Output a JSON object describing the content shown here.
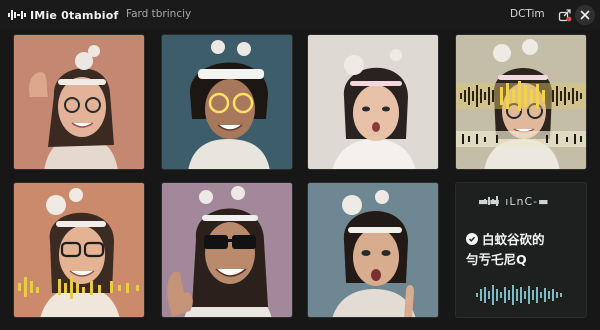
{
  "app": {
    "title": "IMie 0tambiof",
    "subtitle": "Fard tbrinciy",
    "status": "DCTim",
    "icons": {
      "logo": "waveform-logo-icon",
      "share": "share-icon",
      "close": "close-icon"
    }
  },
  "grid": {
    "tiles": [
      {
        "id": "tile-1",
        "subject": "participant-smiling-glasses",
        "bg": "#c98f79"
      },
      {
        "id": "tile-2",
        "subject": "participant-glowing-glasses",
        "bg": "#3e5d6b"
      },
      {
        "id": "tile-3",
        "subject": "participant-surprised",
        "bg": "#dedad3"
      },
      {
        "id": "tile-4",
        "subject": "participant-with-waveform",
        "bg": "#c4bea8",
        "accent": "#d6b84a"
      },
      {
        "id": "tile-5",
        "subject": "participant-glasses-waveform",
        "bg": "#cc8a6d",
        "accent": "#d8c24c"
      },
      {
        "id": "tile-6",
        "subject": "participant-sunglasses",
        "bg": "#a3879b"
      },
      {
        "id": "tile-7",
        "subject": "participant-pointing",
        "bg": "#6f8793"
      }
    ],
    "panel": {
      "top_label": "▬▬ ıLnC-▬",
      "line1": "白蚊谷砍的",
      "line2": "勻亐乇尼Q",
      "bg": "#1e2020"
    }
  }
}
